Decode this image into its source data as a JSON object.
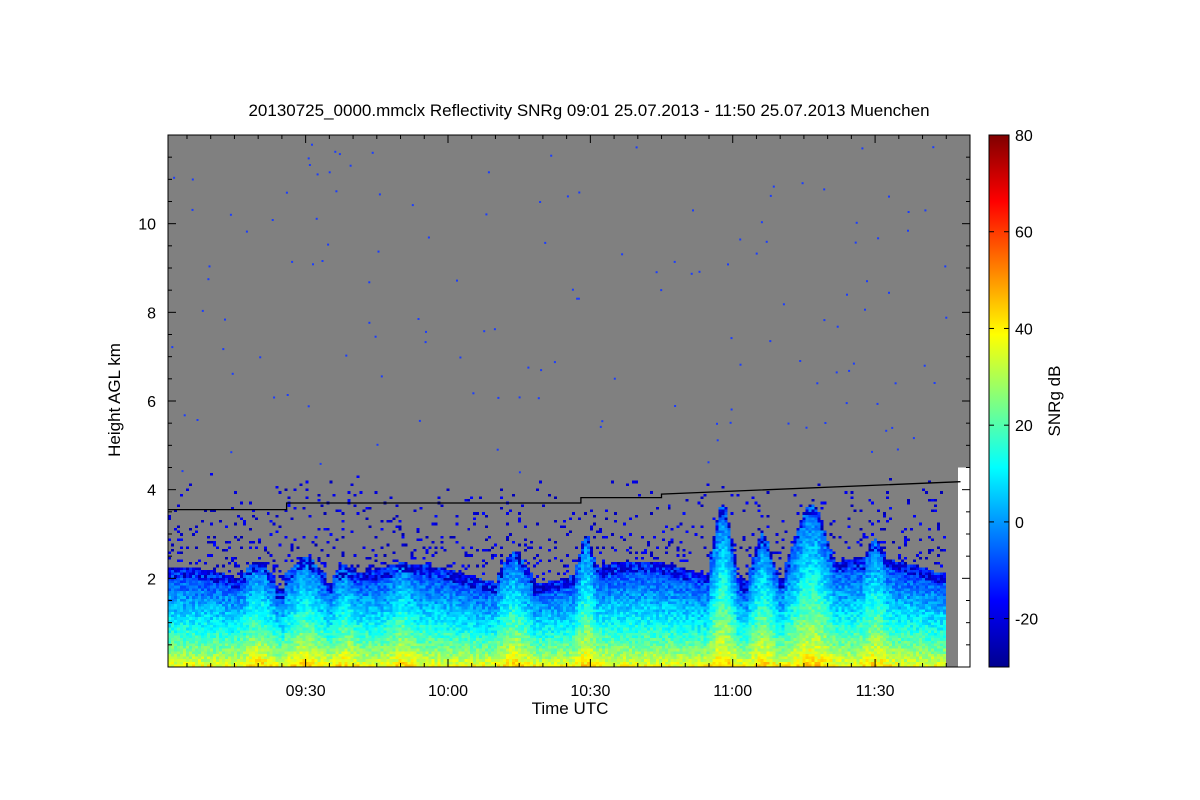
{
  "chart_data": {
    "type": "heatmap",
    "title": "20130725_0000.mmclx Reflectivity SNRg   09:01 25.07.2013 - 11:50 25.07.2013 Muenchen",
    "xlabel": "Time UTC",
    "ylabel": "Height AGL km",
    "colorbar_label": "SNRg dB",
    "x_range": [
      "09:01",
      "11:50"
    ],
    "xlim_minutes_utc": [
      541,
      710
    ],
    "ylim": [
      0,
      12
    ],
    "x_ticks": [
      {
        "label": "09:30",
        "minutes_utc": 570
      },
      {
        "label": "10:00",
        "minutes_utc": 600
      },
      {
        "label": "10:30",
        "minutes_utc": 630
      },
      {
        "label": "11:00",
        "minutes_utc": 660
      },
      {
        "label": "11:30",
        "minutes_utc": 690
      }
    ],
    "y_ticks": [
      2,
      4,
      6,
      8,
      10
    ],
    "colorbar_range": [
      -30,
      80
    ],
    "colorbar_ticks": [
      -20,
      0,
      20,
      40,
      60,
      80
    ],
    "colormap": "jet",
    "background_color": "#808080",
    "grid": false,
    "features": {
      "near_surface_max_snr_db": 40,
      "boundary_layer_top_km": 2.0,
      "convective_plume_max_top_km": 3.7,
      "noise_sparkle_top_km": 4.4,
      "no_data_after_minutes_utc": 705
    },
    "reference_line": {
      "label": "",
      "points": [
        {
          "minutes_utc": 541,
          "km": 3.55
        },
        {
          "minutes_utc": 566,
          "km": 3.55
        },
        {
          "minutes_utc": 566,
          "km": 3.7
        },
        {
          "minutes_utc": 628,
          "km": 3.7
        },
        {
          "minutes_utc": 628,
          "km": 3.82
        },
        {
          "minutes_utc": 645,
          "km": 3.82
        },
        {
          "minutes_utc": 645,
          "km": 3.9
        },
        {
          "minutes_utc": 708,
          "km": 4.18
        }
      ]
    }
  }
}
